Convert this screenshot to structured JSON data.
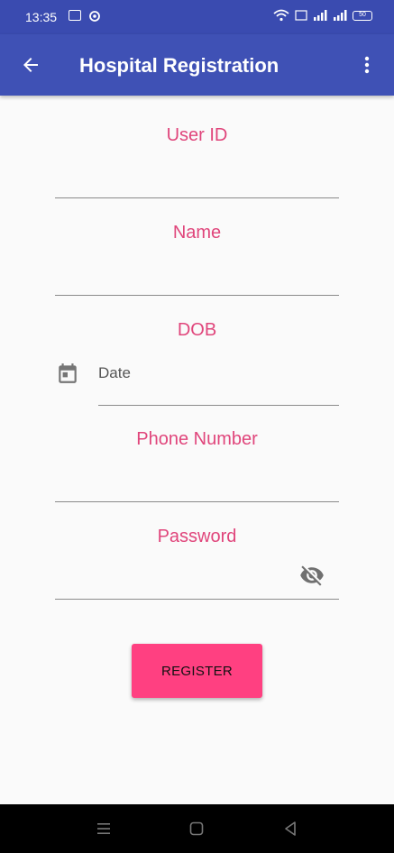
{
  "status_bar": {
    "time": "13:35",
    "battery_level": "50"
  },
  "app_bar": {
    "title": "Hospital Registration",
    "back_icon": "arrow-back-icon",
    "menu_icon": "more-vert-icon"
  },
  "form": {
    "user_id_label": "User ID",
    "name_label": "Name",
    "dob_label": "DOB",
    "date_placeholder": "Date",
    "phone_label": "Phone Number",
    "password_label": "Password",
    "register_label": "REGISTER"
  },
  "colors": {
    "primary": "#3f51b5",
    "label": "#e0457b",
    "accent_button": "#ff4081"
  }
}
